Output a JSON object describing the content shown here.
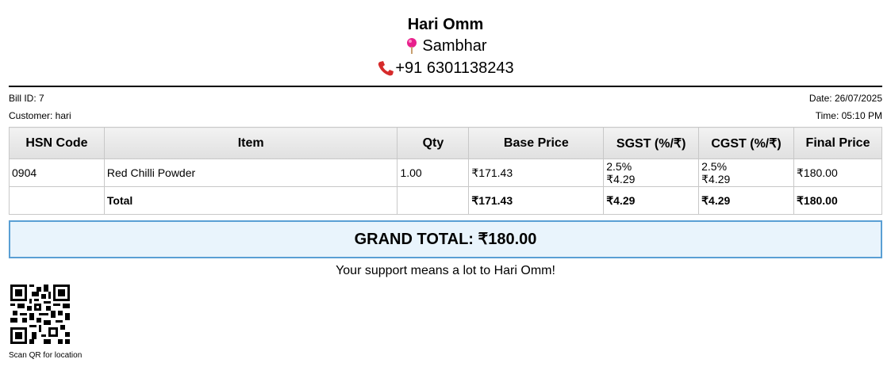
{
  "shop": {
    "name": "Hari Omm",
    "location": "Sambhar",
    "phone": "+91 6301138243",
    "location_icon": "map-pin-icon",
    "phone_icon": "phone-icon"
  },
  "bill": {
    "id_text": "Bill ID: 7",
    "customer_text": "Customer: hari",
    "date_text": "Date: 26/07/2025",
    "time_text": "Time: 05:10 PM"
  },
  "table": {
    "headers": [
      "HSN Code",
      "Item",
      "Qty",
      "Base Price",
      "SGST (%/₹)",
      "CGST (%/₹)",
      "Final Price"
    ],
    "rows": [
      {
        "hsn": "0904",
        "item": "Red Chilli Powder",
        "qty": "1.00",
        "base_price": "₹171.43",
        "sgst_pct": "2.5%",
        "sgst_amt": "₹4.29",
        "cgst_pct": "2.5%",
        "cgst_amt": "₹4.29",
        "final_price": "₹180.00"
      }
    ],
    "total": {
      "label": "Total",
      "base_price": "₹171.43",
      "sgst": "₹4.29",
      "cgst": "₹4.29",
      "final_price": "₹180.00"
    }
  },
  "grand_total": "GRAND TOTAL: ₹180.00",
  "support_message": "Your support means a lot to Hari Omm!",
  "qr_caption": "Scan QR for location",
  "colors": {
    "accent_border": "#5a9fd4",
    "grand_total_bg": "#e9f4fc",
    "pin": "#e8208c",
    "phone": "#d62b2b"
  }
}
